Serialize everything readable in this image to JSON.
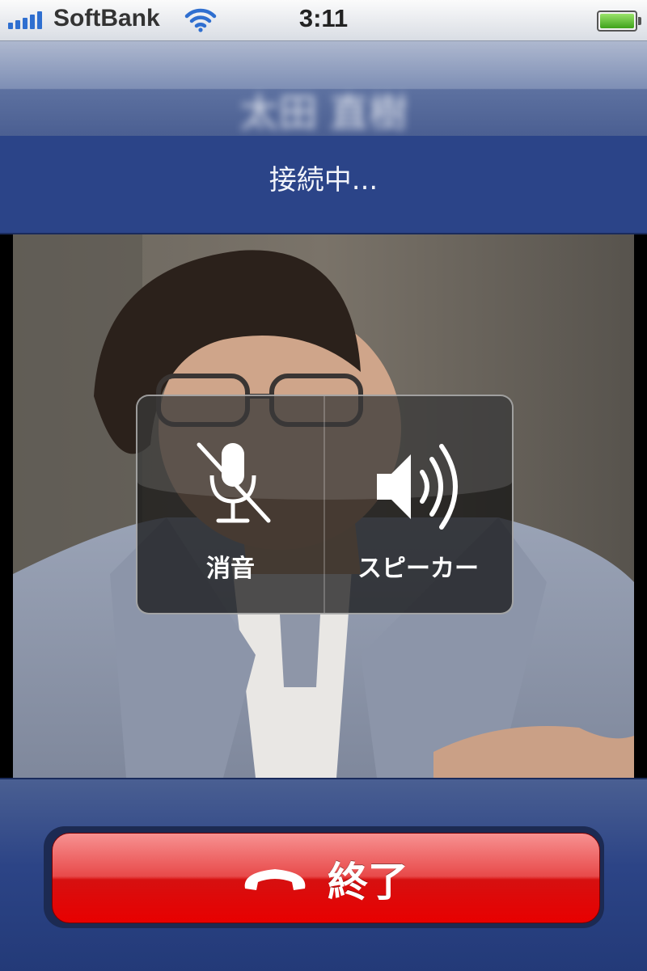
{
  "status_bar": {
    "carrier": "SoftBank",
    "time": "3:11",
    "signal_bars": 5,
    "battery_level": 1.0,
    "icons": [
      "signal-icon",
      "wifi-icon",
      "battery-icon"
    ]
  },
  "caller": {
    "name": "太田 直樹",
    "status": "接続中..."
  },
  "controls": {
    "mute_label": "消音",
    "speaker_label": "スピーカー"
  },
  "end_call": {
    "label": "終了"
  },
  "colors": {
    "header_dark": "#2b4488",
    "end_red": "#e80000",
    "signal_blue": "#2f6fd0"
  }
}
